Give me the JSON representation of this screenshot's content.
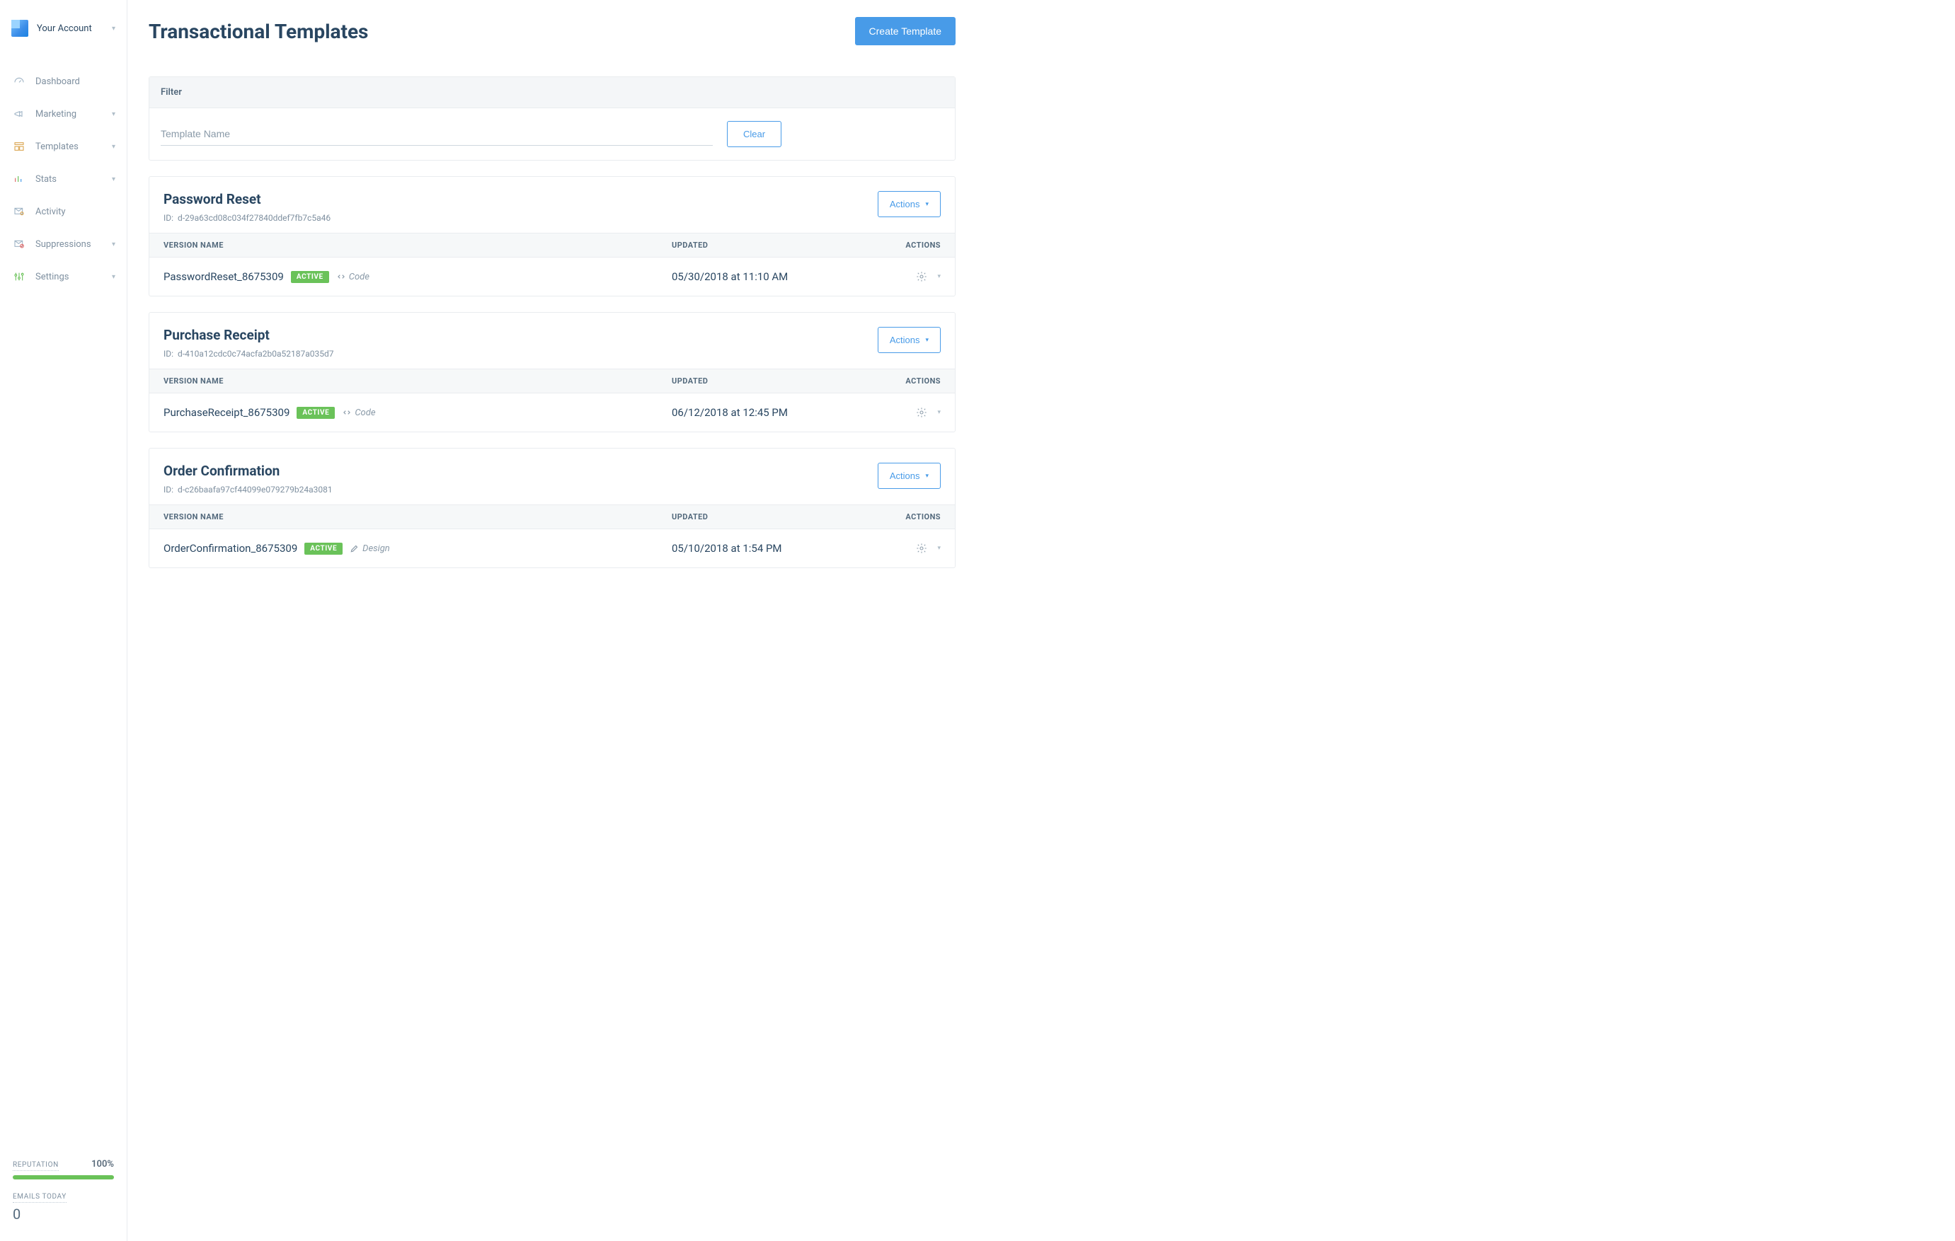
{
  "account_label": "Your Account",
  "sidebar": {
    "items": [
      {
        "label": "Dashboard",
        "chevron": false
      },
      {
        "label": "Marketing",
        "chevron": true
      },
      {
        "label": "Templates",
        "chevron": true
      },
      {
        "label": "Stats",
        "chevron": true
      },
      {
        "label": "Activity",
        "chevron": false
      },
      {
        "label": "Suppressions",
        "chevron": true
      },
      {
        "label": "Settings",
        "chevron": true
      }
    ],
    "reputation_label": "REPUTATION",
    "reputation_pct": "100%",
    "emails_label": "EMAILS TODAY",
    "emails_count": "0"
  },
  "header": {
    "title": "Transactional Templates",
    "create_btn": "Create Template"
  },
  "filter": {
    "heading": "Filter",
    "placeholder": "Template Name",
    "clear": "Clear"
  },
  "columns": {
    "name": "VERSION NAME",
    "updated": "UPDATED",
    "actions": "ACTIONS"
  },
  "actions_btn": "Actions",
  "id_label": "ID:",
  "active_badge": "ACTIVE",
  "editor_code": "Code",
  "editor_design": "Design",
  "templates": [
    {
      "name": "Password Reset",
      "id": "d-29a63cd08c034f27840ddef7fb7c5a46",
      "version_name": "PasswordReset_8675309",
      "editor": "code",
      "updated": "05/30/2018 at 11:10 AM"
    },
    {
      "name": "Purchase Receipt",
      "id": "d-410a12cdc0c74acfa2b0a52187a035d7",
      "version_name": "PurchaseReceipt_8675309",
      "editor": "code",
      "updated": "06/12/2018 at 12:45 PM"
    },
    {
      "name": "Order Confirmation",
      "id": "d-c26baafa97cf44099e079279b24a3081",
      "version_name": "OrderConfirmation_8675309",
      "editor": "design",
      "updated": "05/10/2018 at 1:54 PM"
    }
  ]
}
